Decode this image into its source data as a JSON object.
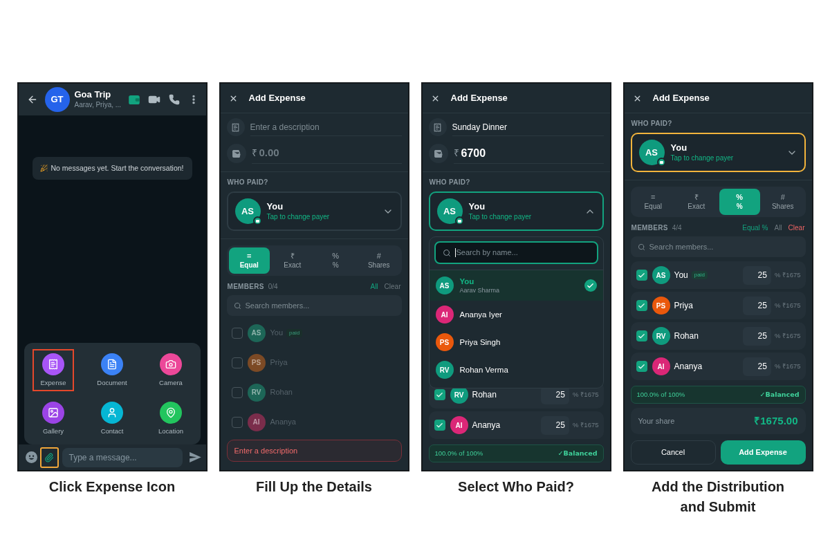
{
  "screens": [
    {
      "kind": "chat",
      "caption": "Click Expense Icon",
      "chat": {
        "avatar_initials": "GT",
        "title": "Goa Trip",
        "subtitle": "Aarav, Priya, ...",
        "notice": "No messages yet. Start the conversation!",
        "attach_menu": [
          {
            "kind": "expense",
            "label": "Expense",
            "color": "#a855f7",
            "highlighted": true
          },
          {
            "kind": "document",
            "label": "Document",
            "color": "#3b82f6",
            "highlighted": false
          },
          {
            "kind": "camera",
            "label": "Camera",
            "color": "#ec4899",
            "highlighted": false
          },
          {
            "kind": "gallery",
            "label": "Gallery",
            "color": "#9b44e6",
            "highlighted": false
          },
          {
            "kind": "contact",
            "label": "Contact",
            "color": "#06b6d4",
            "highlighted": false
          },
          {
            "kind": "location",
            "label": "Location",
            "color": "#22c55e",
            "highlighted": false
          }
        ],
        "composer": {
          "placeholder": "Type a message...",
          "attach_highlighted": true
        }
      }
    },
    {
      "kind": "expense_form",
      "caption": "Fill Up the Details",
      "form": {
        "title": "Add Expense",
        "description": {
          "placeholder": "Enter a description"
        },
        "amount": {
          "currency": "₹",
          "placeholder": "0.00"
        },
        "who_paid_label": "WHO PAID?",
        "payer": {
          "initials": "AS",
          "name": "You",
          "hint": "Tap to change payer",
          "expanded": false,
          "highlighted": false
        },
        "split_tabs": [
          {
            "symbol": "=",
            "label": "Equal",
            "selected": true
          },
          {
            "symbol": "₹",
            "label": "Exact",
            "selected": false
          },
          {
            "symbol": "%",
            "label": "%",
            "selected": false
          },
          {
            "symbol": "#",
            "label": "Shares",
            "selected": false
          }
        ],
        "members_header": {
          "label": "MEMBERS",
          "count": "0/4",
          "actions": [
            {
              "label": "All",
              "color": "#12a37f"
            },
            {
              "label": "Clear",
              "color": "#6b777e"
            }
          ]
        },
        "member_search": {
          "placeholder": "Search members..."
        },
        "members": [
          {
            "initials": "AS",
            "name": "You",
            "badge": "paid",
            "color": "#1d6657",
            "checked": false,
            "disabled": true
          },
          {
            "initials": "PS",
            "name": "Priya",
            "color": "#7c4a25",
            "checked": false,
            "disabled": true
          },
          {
            "initials": "RV",
            "name": "Rohan",
            "color": "#1d6657",
            "checked": false,
            "disabled": true
          },
          {
            "initials": "AI",
            "name": "Ananya",
            "color": "#7a2d4b",
            "checked": false,
            "disabled": true
          }
        ],
        "error": "Enter a description"
      }
    },
    {
      "kind": "expense_form",
      "caption": "Select Who Paid?",
      "form": {
        "title": "Add Expense",
        "description": {
          "value": "Sunday Dinner"
        },
        "amount": {
          "currency": "₹",
          "value": "6700"
        },
        "who_paid_label": "WHO PAID?",
        "payer": {
          "initials": "AS",
          "name": "You",
          "hint": "Tap to change payer",
          "expanded": true,
          "highlighted": false
        },
        "payer_menu": {
          "search_placeholder": "Search by name...",
          "search_focused": true,
          "options": [
            {
              "initials": "AS",
              "name": "You",
              "detail": "Aarav Sharma",
              "color": "#0f9b7e",
              "selected": true
            },
            {
              "initials": "AI",
              "name": "Ananya Iyer",
              "color": "#db2777",
              "selected": false
            },
            {
              "initials": "PS",
              "name": "Priya Singh",
              "color": "#ea580c",
              "selected": false
            },
            {
              "initials": "RV",
              "name": "Rohan Verma",
              "color": "#0f9b7e",
              "selected": false
            }
          ]
        },
        "members": [
          {
            "initials": "RV",
            "name": "Rohan",
            "color": "#0f9b7e",
            "checked": true,
            "disabled": false,
            "value": "25",
            "unit": "%",
            "amount": "₹1675"
          },
          {
            "initials": "AI",
            "name": "Ananya",
            "color": "#db2777",
            "checked": true,
            "disabled": false,
            "value": "25",
            "unit": "%",
            "amount": "₹1675"
          }
        ],
        "summary": {
          "text": "100.0% of 100%",
          "status": "✓Balanced"
        }
      }
    },
    {
      "kind": "expense_form",
      "caption": "Add the Distribution and Submit",
      "form": {
        "title": "Add Expense",
        "who_paid_label": "WHO PAID?",
        "payer": {
          "initials": "AS",
          "name": "You",
          "hint": "Tap to change payer",
          "expanded": false,
          "highlighted": true
        },
        "split_tabs": [
          {
            "symbol": "=",
            "label": "Equal",
            "selected": false
          },
          {
            "symbol": "₹",
            "label": "Exact",
            "selected": false
          },
          {
            "symbol": "%",
            "label": "%",
            "selected": true
          },
          {
            "symbol": "#",
            "label": "Shares",
            "selected": false
          }
        ],
        "members_header": {
          "label": "MEMBERS",
          "count": "4/4",
          "actions": [
            {
              "label": "Equal %",
              "color": "#12a37f"
            },
            {
              "label": "All",
              "color": "#6b777e"
            },
            {
              "label": "Clear",
              "color": "#f06565"
            }
          ]
        },
        "member_search": {
          "placeholder": "Search members..."
        },
        "members": [
          {
            "initials": "AS",
            "name": "You",
            "badge": "paid",
            "color": "#0f9b7e",
            "checked": true,
            "disabled": false,
            "value": "25",
            "unit": "%",
            "amount": "₹1675"
          },
          {
            "initials": "PS",
            "name": "Priya",
            "color": "#ea580c",
            "checked": true,
            "disabled": false,
            "value": "25",
            "unit": "%",
            "amount": "₹1675"
          },
          {
            "initials": "RV",
            "name": "Rohan",
            "color": "#0f9b7e",
            "checked": true,
            "disabled": false,
            "value": "25",
            "unit": "%",
            "amount": "₹1675"
          },
          {
            "initials": "AI",
            "name": "Ananya",
            "color": "#db2777",
            "checked": true,
            "disabled": false,
            "value": "25",
            "unit": "%",
            "amount": "₹1675"
          }
        ],
        "summary": {
          "text": "100.0% of 100%",
          "status": "✓Balanced"
        },
        "your_share": {
          "label": "Your share",
          "amount": "₹1675.00"
        },
        "buttons": [
          {
            "kind": "secondary",
            "label": "Cancel"
          },
          {
            "kind": "primary",
            "label": "Add Expense"
          }
        ]
      }
    }
  ]
}
